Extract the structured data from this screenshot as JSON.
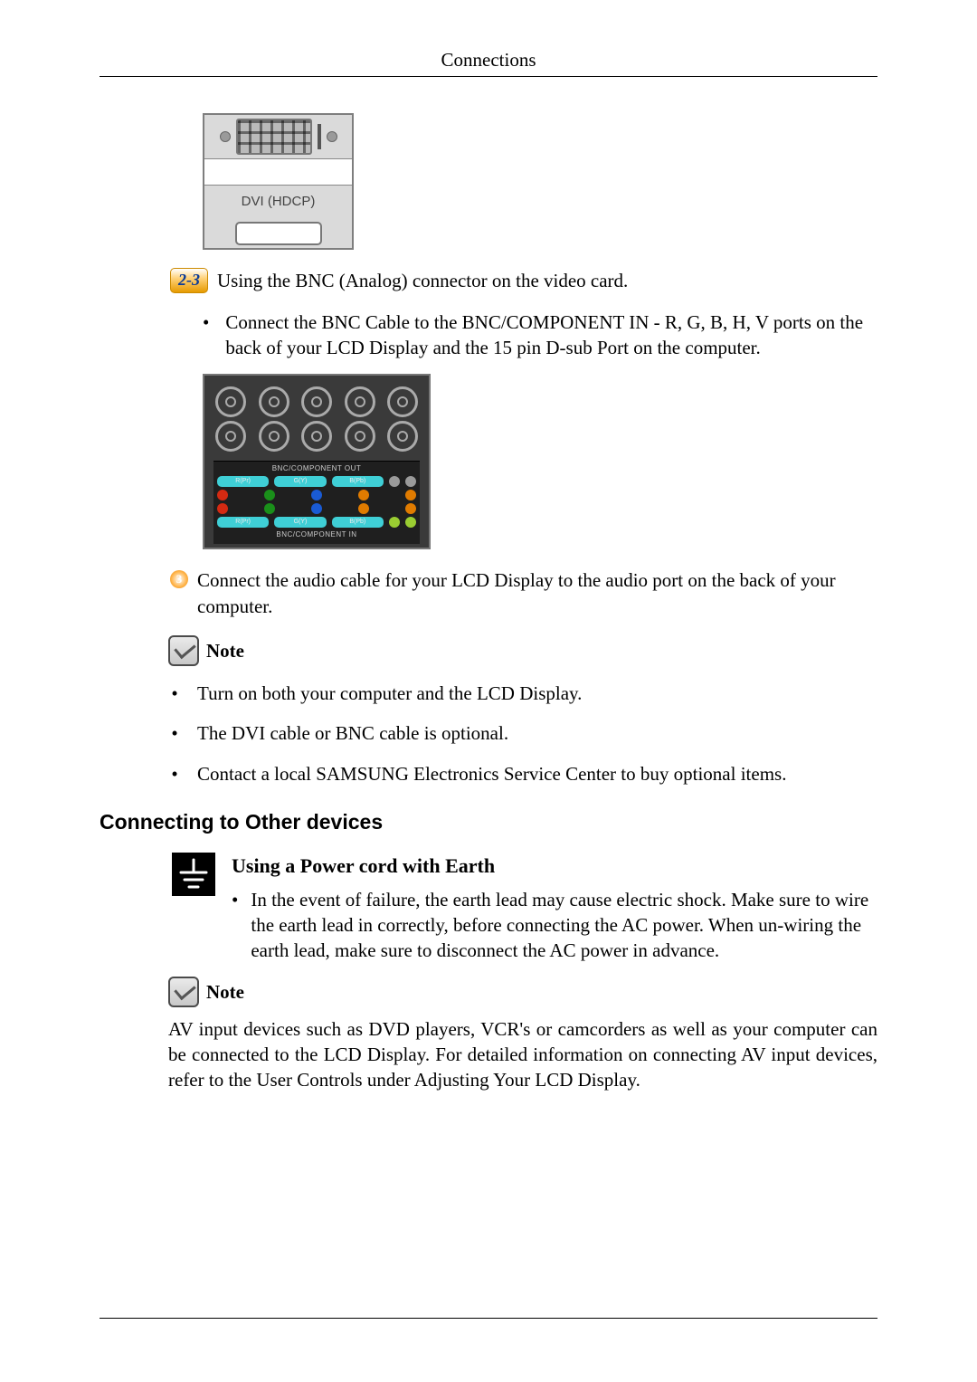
{
  "header": {
    "title": "Connections"
  },
  "dvi": {
    "label": "DVI (HDCP)"
  },
  "badge23": {
    "num": "2-3",
    "text": "Using the BNC (Analog) connector on the video card."
  },
  "bnc_bullet": {
    "dot": "•",
    "text": "Connect the BNC Cable to the BNC/COMPONENT IN - R, G, B, H, V ports on the back of your LCD Display and the 15 pin D-sub Port on the computer."
  },
  "bnc_fig": {
    "out_caption": "BNC/COMPONENT OUT",
    "in_caption": "BNC/COMPONENT IN",
    "lbl_rba": "R(Pr)",
    "lbl_gy": "G(Y)",
    "lbl_bpb": "B(Pb)"
  },
  "circle3": {
    "num": "3",
    "text": "Connect the audio cable for your LCD Display to the audio port on the back of your computer."
  },
  "note1_label": "Note",
  "small_list": {
    "dot": "•",
    "items": [
      "Turn on both your computer and the LCD Display.",
      "The DVI cable or BNC cable is optional.",
      "Contact a local SAMSUNG Electronics Service Center to buy optional items."
    ]
  },
  "section_heading": "Connecting to Other devices",
  "earth": {
    "heading": "Using a Power cord with Earth",
    "bullet": "•",
    "desc": "In the event of failure, the earth lead may cause electric shock. Make sure to wire the earth lead in correctly, before connecting the AC power. When un-wiring the earth lead, make sure to disconnect the AC power in advance."
  },
  "note2_label": "Note",
  "av_para": "AV input devices such as DVD players, VCR's or camcorders as well as your computer can be connected to the LCD Display. For detailed information on connecting AV input devices, refer to the User Controls under Adjusting Your LCD Display."
}
